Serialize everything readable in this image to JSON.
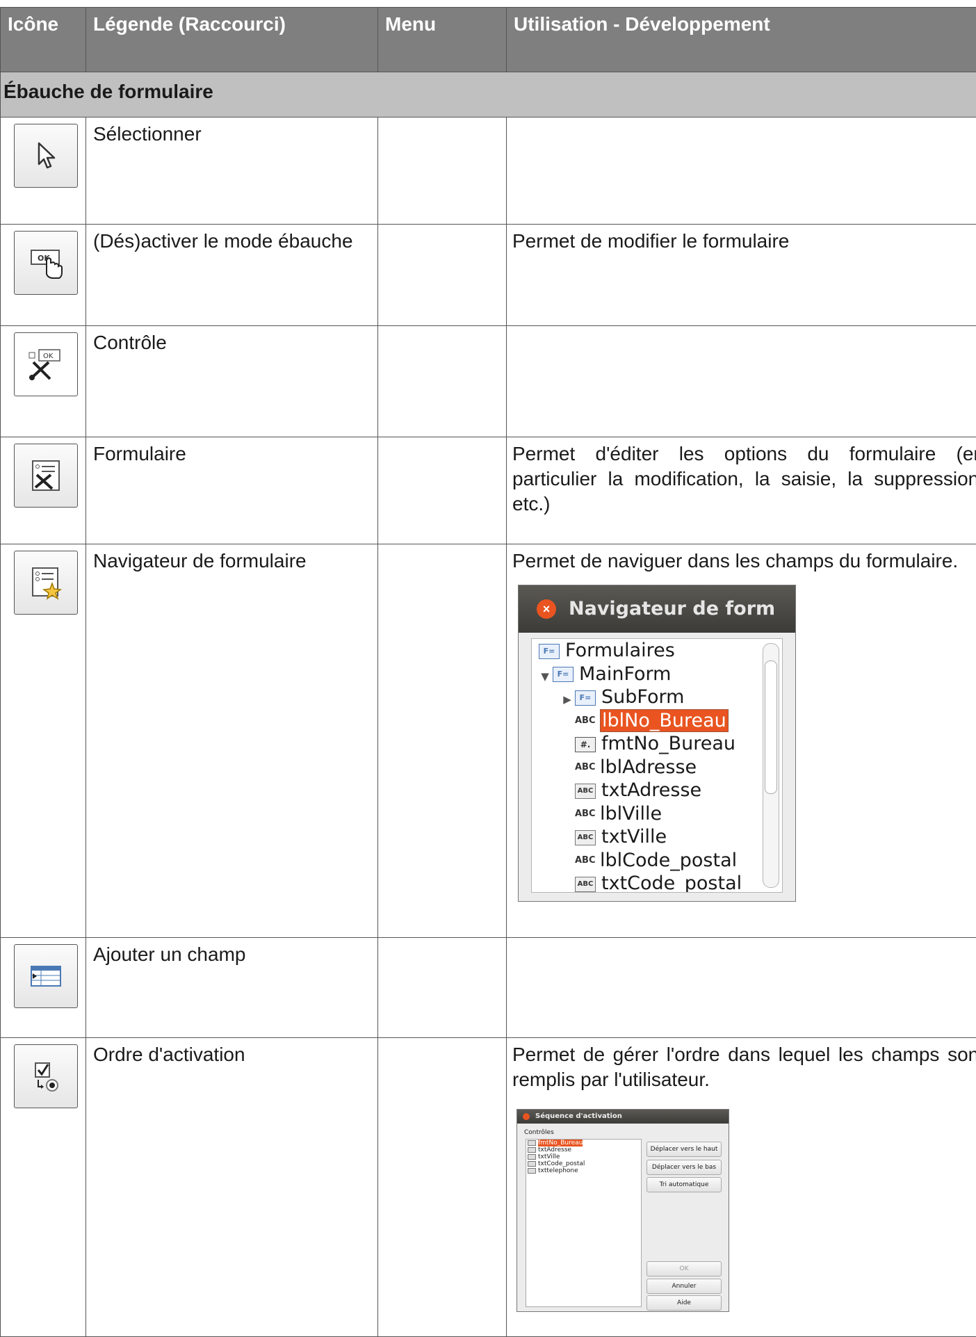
{
  "headers": {
    "icon": "Icône",
    "legend": "Légende (Raccourci)",
    "menu": "Menu",
    "usage": "Utilisation  - Développement"
  },
  "section": "Ébauche de formulaire",
  "rows": [
    {
      "icon": "pointer-arrow-icon",
      "legend": "Sélectionner",
      "menu": "",
      "usage": ""
    },
    {
      "icon": "design-mode-toggle-icon",
      "legend": "(Dés)activer le mode ébauche",
      "menu": "",
      "usage": "Permet de modifier le formulaire"
    },
    {
      "icon": "control-properties-icon",
      "legend": "Contrôle",
      "menu": "",
      "usage": ""
    },
    {
      "icon": "form-properties-icon",
      "legend": "Formulaire",
      "menu": "",
      "usage": "Permet d'éditer les options du formulaire (en particulier la modification, la saisie, la suppression, etc.)"
    },
    {
      "icon": "form-navigator-icon",
      "legend": "Navigateur de formulaire",
      "menu": "",
      "usage": "Permet de naviguer dans les champs du formulaire."
    },
    {
      "icon": "add-field-icon",
      "legend": "Ajouter un champ",
      "menu": "",
      "usage": ""
    },
    {
      "icon": "activation-order-icon",
      "legend": "Ordre d'activation",
      "menu": "",
      "usage": "Permet de gérer l'ordre dans lequel les champs sont remplis par l'utilisateur."
    }
  ],
  "navigator": {
    "title": "Navigateur de form",
    "items": [
      {
        "label": "Formulaires",
        "kind": "forms"
      },
      {
        "label": "MainForm",
        "kind": "form"
      },
      {
        "label": "SubForm",
        "kind": "form"
      },
      {
        "label": "lblNo_Bureau",
        "kind": "label"
      },
      {
        "label": "fmtNo_Bureau",
        "kind": "formatted"
      },
      {
        "label": "lblAdresse",
        "kind": "label"
      },
      {
        "label": "txtAdresse",
        "kind": "text"
      },
      {
        "label": "lblVille",
        "kind": "label"
      },
      {
        "label": "txtVille",
        "kind": "text"
      },
      {
        "label": "lblCode_postal",
        "kind": "label"
      },
      {
        "label": "txtCode_postal",
        "kind": "text"
      }
    ],
    "icon_abc": "ABC",
    "icon_form": "F=",
    "icon_num": "#."
  },
  "sequence": {
    "title": "Séquence d'activation",
    "controls_label": "Contrôles",
    "items": [
      "fmtNo_Bureau",
      "txtAdresse",
      "txtVille",
      "txtCode_postal",
      "txttelephone"
    ],
    "btn_up": "Déplacer vers le haut",
    "btn_down": "Déplacer vers le bas",
    "btn_sort": "Tri automatique",
    "btn_ok": "OK",
    "btn_cancel": "Annuler",
    "btn_help": "Aide"
  },
  "colors": {
    "header_bg": "#7f7f7f",
    "section_bg": "#c0c0c0",
    "accent": "#e95420"
  }
}
